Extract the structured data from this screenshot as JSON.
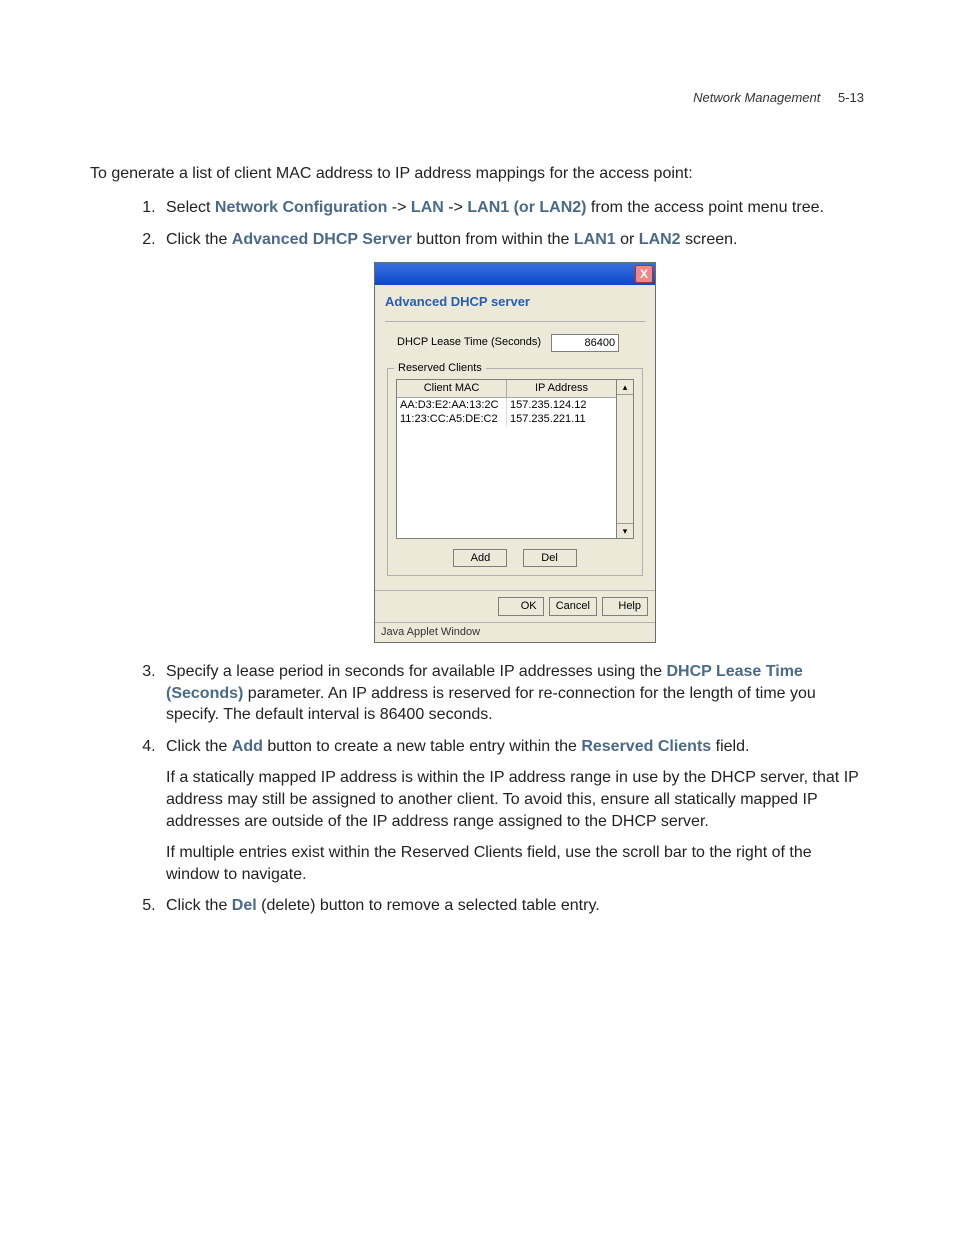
{
  "header": {
    "section": "Network Management",
    "page": "5-13"
  },
  "intro": "To generate a list of client MAC address to IP address mappings for the access point:",
  "steps": {
    "s1": {
      "prefix": "Select ",
      "b1": "Network Configuration",
      "sep1": " -> ",
      "b2": "LAN",
      "sep2": " -> ",
      "b3": "LAN1 (or LAN2)",
      "suffix": " from the access point menu tree."
    },
    "s2": {
      "prefix": "Click the ",
      "b1": "Advanced DHCP Server",
      "mid": " button from within the ",
      "b2": "LAN1",
      "or": " or ",
      "b3": "LAN2",
      "suffix": " screen."
    },
    "s3": {
      "prefix": "Specify a lease period in seconds for available IP addresses using the ",
      "b1": "DHCP Lease Time (Seconds)",
      "suffix": " parameter. An IP address is reserved for re-connection for the length of time you specify. The default interval is 86400 seconds."
    },
    "s4": {
      "prefix": "Click the ",
      "b1": "Add",
      "mid": " button to create a new table entry within the ",
      "b2": "Reserved Clients",
      "suffix": " field.",
      "p2": "If a statically mapped IP address is within the IP address range in use by the DHCP server, that IP address may still be assigned to another client. To avoid this, ensure all statically mapped IP addresses are outside of the IP address range assigned to the DHCP server.",
      "p3": "If multiple entries exist within the Reserved Clients field, use the scroll bar to the right of the window to navigate."
    },
    "s5": {
      "prefix": "Click the ",
      "b1": "Del",
      "suffix": " (delete) button to remove a selected table entry."
    }
  },
  "dialog": {
    "close_x": "X",
    "title": "Advanced DHCP server",
    "lease_label": "DHCP Lease Time (Seconds)",
    "lease_value": "86400",
    "reserved_label": "Reserved Clients",
    "col_mac": "Client MAC",
    "col_ip": "IP Address",
    "rows": [
      {
        "mac": "AA:D3:E2:AA:13:2C",
        "ip": "157.235.124.12"
      },
      {
        "mac": "11:23:CC:A5:DE:C2",
        "ip": "157.235.221.11"
      }
    ],
    "btn_add": "Add",
    "btn_del": "Del",
    "btn_ok": "OK",
    "btn_cancel": "Cancel",
    "btn_help": "Help",
    "status": "Java Applet Window"
  }
}
